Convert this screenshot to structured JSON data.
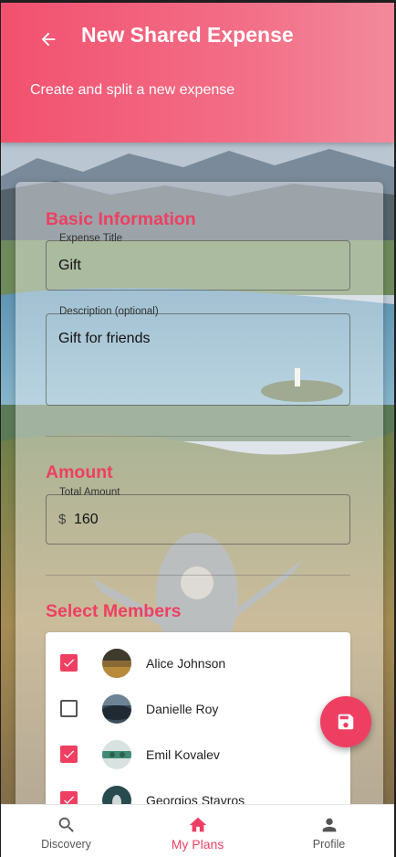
{
  "header": {
    "title": "New Shared Expense",
    "subtitle": "Create and split a new expense",
    "back_icon": "arrow-left-icon"
  },
  "basic_info": {
    "section_title": "Basic Information",
    "title_field": {
      "label": "Expense Title",
      "value": "Gift"
    },
    "description_field": {
      "label": "Description (optional)",
      "value": "Gift for friends"
    }
  },
  "amount": {
    "section_title": "Amount",
    "total_field": {
      "label": "Total Amount",
      "currency": "$",
      "value": "160"
    }
  },
  "members": {
    "section_title": "Select Members",
    "items": [
      {
        "name": "Alice Johnson",
        "checked": true
      },
      {
        "name": "Danielle Roy",
        "checked": false
      },
      {
        "name": "Emil Kovalev",
        "checked": true
      },
      {
        "name": "Georgios Stavros",
        "checked": true
      }
    ]
  },
  "fab": {
    "icon": "save-icon"
  },
  "bottom_nav": {
    "items": [
      {
        "label": "Discovery",
        "icon": "search-icon"
      },
      {
        "label": "My Plans",
        "icon": "home-icon",
        "active": true
      },
      {
        "label": "Profile",
        "icon": "person-icon"
      }
    ]
  },
  "colors": {
    "accent": "#ee3f62",
    "header_start": "#f2516f",
    "header_end": "#f28a9c"
  }
}
